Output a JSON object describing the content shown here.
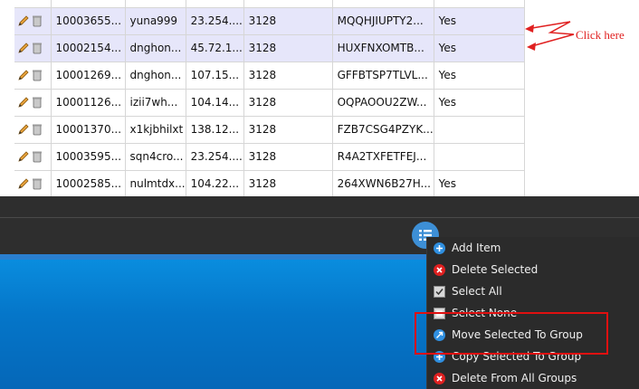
{
  "table": {
    "rows": [
      {
        "id": "",
        "user": "",
        "ip": "",
        "port": "",
        "key": "",
        "flag": "",
        "selected": false
      },
      {
        "id": "10003655...",
        "user": "yuna999",
        "ip": "23.254....",
        "port": "3128",
        "key": "MQQHJIUPTY2...",
        "flag": "Yes",
        "selected": true
      },
      {
        "id": "10002154...",
        "user": "dnghon...",
        "ip": "45.72.1...",
        "port": "3128",
        "key": "HUXFNXOMTB...",
        "flag": "Yes",
        "selected": true
      },
      {
        "id": "10001269...",
        "user": "dnghon...",
        "ip": "107.15...",
        "port": "3128",
        "key": "GFFBTSP7TLVL...",
        "flag": "Yes",
        "selected": false
      },
      {
        "id": "10001126...",
        "user": "izii7wh...",
        "ip": "104.14...",
        "port": "3128",
        "key": "OQPAOOU2ZW...",
        "flag": "Yes",
        "selected": false
      },
      {
        "id": "10001370...",
        "user": "x1kjbhilxt",
        "ip": "138.12...",
        "port": "3128",
        "key": "FZB7CSG4PZYK...",
        "flag": "",
        "selected": false
      },
      {
        "id": "10003595...",
        "user": "sqn4cro...",
        "ip": "23.254....",
        "port": "3128",
        "key": "R4A2TXFETFEJ...",
        "flag": "",
        "selected": false
      },
      {
        "id": "10002585...",
        "user": "nulmtdx...",
        "ip": "104.22...",
        "port": "3128",
        "key": "264XWN6B27H...",
        "flag": "Yes",
        "selected": false
      }
    ]
  },
  "annotation": {
    "text": "Click here",
    "color": "#e02020"
  },
  "menu": {
    "items": [
      {
        "label": "Add Item",
        "icon": "plus-circle-icon",
        "color": "#2f8fe0"
      },
      {
        "label": "Delete Selected",
        "icon": "x-circle-icon",
        "color": "#e02020"
      },
      {
        "label": "Select All",
        "icon": "checkbox-checked-icon",
        "color": "#d8d8d8"
      },
      {
        "label": "Select None",
        "icon": "checkbox-empty-icon",
        "color": "#d8d8d8"
      },
      {
        "label": "Move Selected To Group",
        "icon": "move-arrow-icon",
        "color": "#2f8fe0"
      },
      {
        "label": "Copy Selected To Group",
        "icon": "plus-circle-icon",
        "color": "#2f8fe0"
      },
      {
        "label": "Delete From All Groups",
        "icon": "x-circle-icon",
        "color": "#e02020"
      }
    ]
  },
  "colors": {
    "accent": "#3d8fd6",
    "selection": "#e6e6fa",
    "highlight": "#e01010",
    "menu_bg": "#2b2b2b",
    "desktop": "#0a8fe0"
  }
}
